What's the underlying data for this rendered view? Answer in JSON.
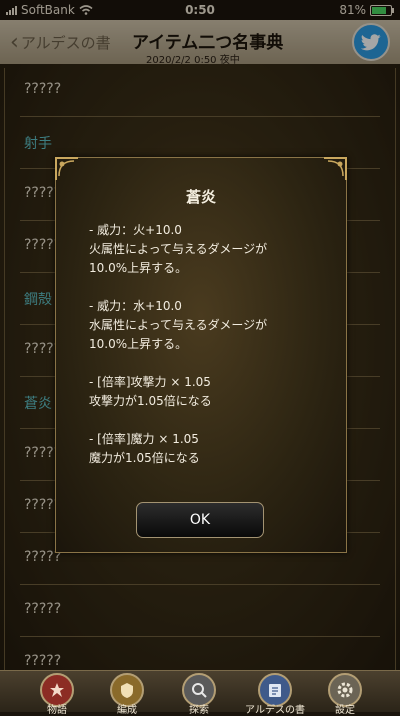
{
  "status_bar": {
    "carrier": "SoftBank",
    "time": "0:50",
    "battery": "81%",
    "battery_level": 0.81
  },
  "header": {
    "back_label": "アルデスの書",
    "title": "アイテム二つ名事典",
    "subtitle": "2020/2/2  0:50  夜中",
    "twitter_icon": "twitter-icon"
  },
  "list": {
    "rows": [
      {
        "label": "?????",
        "type": "item"
      },
      {
        "label": "射手",
        "type": "section"
      },
      {
        "label": "?????",
        "type": "item"
      },
      {
        "label": "?????",
        "type": "item"
      },
      {
        "label": "鋼殻",
        "type": "section"
      },
      {
        "label": "?????",
        "type": "item"
      },
      {
        "label": "蒼炎",
        "type": "section"
      },
      {
        "label": "?????",
        "type": "item"
      },
      {
        "label": "?????",
        "type": "item"
      },
      {
        "label": "?????",
        "type": "item"
      },
      {
        "label": "?????",
        "type": "item"
      },
      {
        "label": "?????",
        "type": "item"
      }
    ]
  },
  "dialog": {
    "title": "蒼炎",
    "effects": [
      {
        "line1": "- 威力：火+10.0",
        "line2": "火属性によって与えるダメージが",
        "line3": "10.0%上昇する。"
      },
      {
        "line1": "- 威力：水+10.0",
        "line2": "水属性によって与えるダメージが",
        "line3": "10.0%上昇する。"
      },
      {
        "line1": "- [倍率]攻撃力 × 1.05",
        "line2": "攻撃力が1.05倍になる",
        "line3": ""
      },
      {
        "line1": "- [倍率]魔力 × 1.05",
        "line2": "魔力が1.05倍になる",
        "line3": ""
      }
    ],
    "ok_label": "OK"
  },
  "tabbar": {
    "tabs": [
      {
        "label": "物語",
        "icon": "story-icon"
      },
      {
        "label": "編成",
        "icon": "formation-icon"
      },
      {
        "label": "探索",
        "icon": "explore-icon"
      },
      {
        "label": "アルデスの書",
        "icon": "book-icon"
      },
      {
        "label": "設定",
        "icon": "settings-icon"
      }
    ]
  },
  "colors": {
    "section_label": "#5fc1c6",
    "twitter_blue": "#2d9be2",
    "battery_green": "#4cd964"
  }
}
